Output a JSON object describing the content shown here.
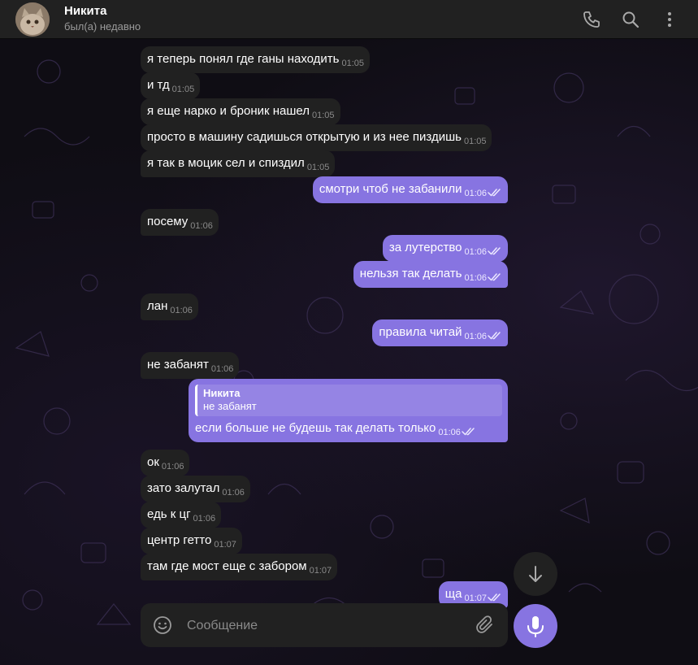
{
  "header": {
    "contact_name": "Никита",
    "status": "был(а) недавно"
  },
  "icons": {
    "call": "phone-icon",
    "search": "search-icon",
    "menu": "more-vertical-icon",
    "emoji": "emoji-icon",
    "attach": "paperclip-icon",
    "mic": "microphone-icon",
    "scroll": "arrow-down-icon"
  },
  "colors": {
    "outgoing_bubble": "#8774e1",
    "incoming_bubble": "#212121",
    "background": "#0f0d14"
  },
  "messages": [
    {
      "dir": "in",
      "text": "я теперь понял где ганы находить",
      "time": "01:05"
    },
    {
      "dir": "in",
      "text": "и тд",
      "time": "01:05"
    },
    {
      "dir": "in",
      "text": "я еще нарко и броник нашел",
      "time": "01:05"
    },
    {
      "dir": "in",
      "text": "просто в машину садишься открытую и из нее пиздишь",
      "time": "01:05"
    },
    {
      "dir": "in",
      "text": "я так в моцик сел и спиздил",
      "time": "01:05"
    },
    {
      "dir": "out",
      "text": "смотри чтоб не забанили",
      "time": "01:06"
    },
    {
      "dir": "in",
      "text": "посему",
      "time": "01:06"
    },
    {
      "dir": "out",
      "text": "за лутерство",
      "time": "01:06"
    },
    {
      "dir": "out",
      "text": "нельзя так делать",
      "time": "01:06"
    },
    {
      "dir": "in",
      "text": "лан",
      "time": "01:06"
    },
    {
      "dir": "out",
      "text": "правила читай",
      "time": "01:06"
    },
    {
      "dir": "in",
      "text": "не забанят",
      "time": "01:06"
    },
    {
      "dir": "out",
      "text": "если больше не будешь так делать только",
      "time": "01:06",
      "reply_name": "Никита",
      "reply_text": "не забанят"
    },
    {
      "dir": "in",
      "text": "ок",
      "time": "01:06"
    },
    {
      "dir": "in",
      "text": "зато залутал",
      "time": "01:06"
    },
    {
      "dir": "in",
      "text": "едь к цг",
      "time": "01:06"
    },
    {
      "dir": "in",
      "text": "центр гетто",
      "time": "01:07"
    },
    {
      "dir": "in",
      "text": "там где мост еще с забором",
      "time": "01:07"
    },
    {
      "dir": "out",
      "text": "ща",
      "time": "01:07"
    }
  ],
  "composer": {
    "placeholder": "Сообщение"
  }
}
